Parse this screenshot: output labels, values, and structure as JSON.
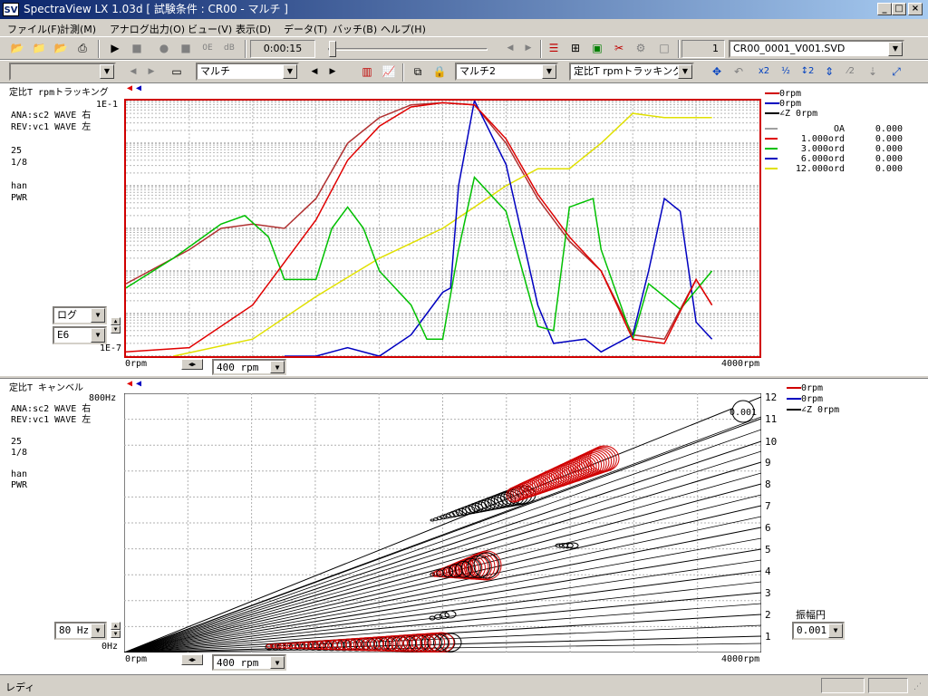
{
  "window": {
    "title": "SpectraView LX 1.03d [ 試験条件 : CR00 - マルチ ]",
    "logo": "SV",
    "min": "_",
    "max": "□",
    "close": "×"
  },
  "menu": [
    "ファイル(F)",
    "計測(M)",
    "アナログ出力(O)",
    "ビュー(V)",
    "表示(D)",
    "データ(T)",
    "バッチ(B)",
    "ヘルプ(H)"
  ],
  "toolbar1": {
    "time": "0:00:15",
    "count": "1",
    "file": "CR00_0001_V001.SVD"
  },
  "toolbar2": {
    "combo1": "マルチ",
    "combo2": "マルチ2",
    "combo3": "定比T rpmトラッキング"
  },
  "top_panel": {
    "title": "定比T rpmトラッキング",
    "info": [
      "ANA:sc2 WAVE 右",
      "REV:vc1 WAVE 左",
      "",
      "25",
      "1/8",
      "",
      "han",
      "PWR"
    ],
    "ytop": "1E-1",
    "ybot": "1E-7",
    "xleft": "0rpm",
    "xright": "4000rpm",
    "scale_combo": "ログ",
    "range_combo": "E6",
    "xstep": "400 rpm",
    "legend_top": [
      {
        "text": "0rpm",
        "color": "#d00000"
      },
      {
        "text": "0rpm",
        "color": "#0000c0"
      },
      {
        "text": "∠Z 0rpm",
        "color": "#000000"
      }
    ],
    "legend_rows": [
      {
        "name": "OA",
        "val": "0.000",
        "color": "#a0a0a0"
      },
      {
        "name": "1.000ord",
        "val": "0.000",
        "color": "#e00000"
      },
      {
        "name": "3.000ord",
        "val": "0.000",
        "color": "#00c000"
      },
      {
        "name": "6.000ord",
        "val": "0.000",
        "color": "#0000c0"
      },
      {
        "name": "12.000ord",
        "val": "0.000",
        "color": "#e0e000"
      }
    ]
  },
  "bottom_panel": {
    "title": "定比T キャンベル",
    "info": [
      "ANA:sc2 WAVE 右",
      "REV:vc1 WAVE 左",
      "",
      "25",
      "1/8",
      "",
      "han",
      "PWR"
    ],
    "ytop": "800Hz",
    "ybot": "0Hz",
    "xleft": "0rpm",
    "xright": "4000rpm",
    "y_combo": "80 Hz",
    "xstep": "400 rpm",
    "legend": [
      {
        "text": "0rpm",
        "color": "#d00000"
      },
      {
        "text": "0rpm",
        "color": "#0000c0"
      },
      {
        "text": "∠Z 0rpm",
        "color": "#000000"
      }
    ],
    "orders": [
      "12",
      "11",
      "10",
      "9",
      "8",
      "7",
      "6",
      "5",
      "4",
      "3",
      "2",
      "1"
    ],
    "amp_label": "振幅円",
    "amp_value": "0.001",
    "amp_circle": "0.001"
  },
  "status": "レディ",
  "colors": {
    "orange": "#e4a020",
    "red": "#e00000",
    "green": "#00c000",
    "blue": "#0000c0",
    "yellow": "#e0e000",
    "dark_red": "#b03030"
  },
  "chart_data": [
    {
      "type": "line",
      "title": "定比T rpmトラッキング",
      "xlabel": "rpm",
      "xlim": [
        0,
        4000
      ],
      "ylim": [
        "1E-7",
        "1E-1"
      ],
      "yscale": "log",
      "series": [
        {
          "name": "1.000ord",
          "x": [
            0,
            400,
            800,
            1200,
            1400,
            1600,
            1800,
            2000,
            2200,
            2400,
            2600,
            2800,
            3000,
            3200,
            3400,
            3600,
            3700
          ],
          "log10y": [
            -6.9,
            -6.8,
            -5.8,
            -3.8,
            -2.4,
            -1.6,
            -1.15,
            -1.05,
            -1.1,
            -1.9,
            -3.2,
            -4.2,
            -5.0,
            -6.6,
            -6.7,
            -5.2,
            -5.8
          ]
        },
        {
          "name": "3.000ord",
          "x": [
            0,
            300,
            600,
            750,
            900,
            1000,
            1200,
            1300,
            1400,
            1500,
            1600,
            1800,
            1900,
            2000,
            2100,
            2200,
            2400,
            2600,
            2700,
            2800,
            2950,
            3000,
            3200,
            3300,
            3500,
            3700
          ],
          "log10y": [
            -5.4,
            -4.7,
            -3.9,
            -3.7,
            -4.2,
            -5.2,
            -5.2,
            -4.0,
            -3.5,
            -4.0,
            -5.0,
            -5.8,
            -6.6,
            -6.6,
            -4.5,
            -2.8,
            -3.6,
            -6.3,
            -6.4,
            -3.5,
            -3.3,
            -4.5,
            -6.6,
            -5.3,
            -5.9,
            -5.0
          ]
        },
        {
          "name": "6.000ord",
          "x": [
            1000,
            1200,
            1400,
            1600,
            1800,
            1900,
            2000,
            2050,
            2100,
            2200,
            2400,
            2600,
            2700,
            2900,
            3000,
            3200,
            3300,
            3400,
            3500,
            3600,
            3700
          ],
          "log10y": [
            -7.0,
            -7.0,
            -6.8,
            -7.0,
            -6.5,
            -6.0,
            -5.5,
            -5.4,
            -3.0,
            -1.0,
            -2.5,
            -5.8,
            -6.7,
            -6.6,
            -6.9,
            -6.5,
            -5.0,
            -3.3,
            -3.6,
            -6.2,
            -6.6
          ]
        },
        {
          "name": "12.000ord",
          "x": [
            300,
            800,
            1200,
            1600,
            2000,
            2200,
            2400,
            2600,
            2800,
            3000,
            3200,
            3400,
            3600,
            3700
          ],
          "log10y": [
            -7.0,
            -6.6,
            -5.6,
            -4.7,
            -4.0,
            -3.5,
            -3.0,
            -2.6,
            -2.6,
            -2.0,
            -1.3,
            -1.4,
            -1.4,
            -1.4
          ]
        },
        {
          "name": "OA",
          "x": [
            0,
            200,
            400,
            600,
            800,
            1000,
            1200,
            1400,
            1600,
            1800,
            2000,
            2200,
            2400,
            2600,
            2800,
            3000,
            3200,
            3400,
            3600,
            3700
          ],
          "log10y": [
            -5.3,
            -4.9,
            -4.5,
            -4.0,
            -3.9,
            -4.0,
            -3.3,
            -2.0,
            -1.4,
            -1.1,
            -1.05,
            -1.1,
            -2.0,
            -3.3,
            -4.3,
            -5.0,
            -6.5,
            -6.6,
            -5.2,
            -5.8
          ]
        }
      ]
    },
    {
      "type": "scatter",
      "title": "定比T キャンベル",
      "xlabel": "rpm",
      "ylabel": "Hz",
      "xlim": [
        0,
        4000
      ],
      "ylim": [
        0,
        800
      ],
      "orders": [
        1,
        2,
        3,
        4,
        5,
        6,
        7,
        8,
        9,
        10,
        11,
        12
      ],
      "series": [
        {
          "name": "1.000ord",
          "x": [
            900,
            1200,
            1500,
            1800,
            2000
          ],
          "y": [
            15,
            20,
            25,
            30,
            33
          ]
        },
        {
          "name": "3.000ord",
          "x": [
            1900,
            2050,
            2200,
            2250
          ],
          "y": [
            200,
            205,
            210,
            215
          ]
        },
        {
          "name": "6.000ord",
          "x": [
            2500,
            2800,
            3000,
            3100
          ],
          "y": [
            485,
            500,
            510,
            510
          ]
        }
      ]
    }
  ]
}
